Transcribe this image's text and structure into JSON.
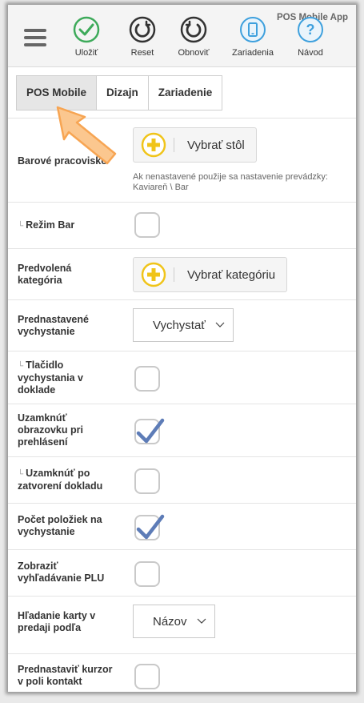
{
  "toolbar": {
    "app_title": "POS Mobile App",
    "buttons": [
      {
        "label": "Uložiť",
        "icon": "check-circle-icon"
      },
      {
        "label": "Reset",
        "icon": "reset-icon"
      },
      {
        "label": "Obnoviť",
        "icon": "refresh-icon"
      },
      {
        "label": "Zariadenia",
        "icon": "device-icon"
      },
      {
        "label": "Návod",
        "icon": "help-icon"
      }
    ]
  },
  "tabs": [
    {
      "label": "POS Mobile",
      "active": true
    },
    {
      "label": "Dizajn",
      "active": false
    },
    {
      "label": "Zariadenie",
      "active": false
    }
  ],
  "settings": {
    "bar_workplace": {
      "label": "Barové pracovisko",
      "button_label": "Vybrať stôl",
      "hint": "Ak nenastavené použije sa nastavenie prevádzky: Kaviareň \\ Bar"
    },
    "bar_mode": {
      "label": "Režim Bar",
      "checked": false
    },
    "default_category": {
      "label": "Predvolená kategória",
      "button_label": "Vybrať kategóriu"
    },
    "default_preparation": {
      "label": "Prednastavené vychystanie",
      "value": "Vychystať"
    },
    "preparation_button": {
      "label": "Tlačidlo vychystania v doklade",
      "checked": false
    },
    "lock_on_login": {
      "label": "Uzamknúť obrazovku pri prehlásení",
      "checked": true
    },
    "lock_after_close": {
      "label": "Uzamknúť po zatvorení dokladu",
      "checked": false
    },
    "item_count": {
      "label": "Počet položiek na vychystanie",
      "checked": true
    },
    "show_plu_search": {
      "label": "Zobraziť vyhľadávanie PLU",
      "checked": false
    },
    "card_search": {
      "label": "Hľadanie karty v predaji podľa",
      "value": "Názov"
    },
    "cursor_contact": {
      "label": "Prednastaviť kurzor v poli kontakt",
      "checked": false
    }
  },
  "sub_marker": "└",
  "colors": {
    "accent_green": "#3daa5a",
    "accent_blue": "#3ea0dd",
    "check_blue": "#5d7cb7",
    "plus_yellow": "#f0c419",
    "pointer_orange": "#f7a553"
  }
}
